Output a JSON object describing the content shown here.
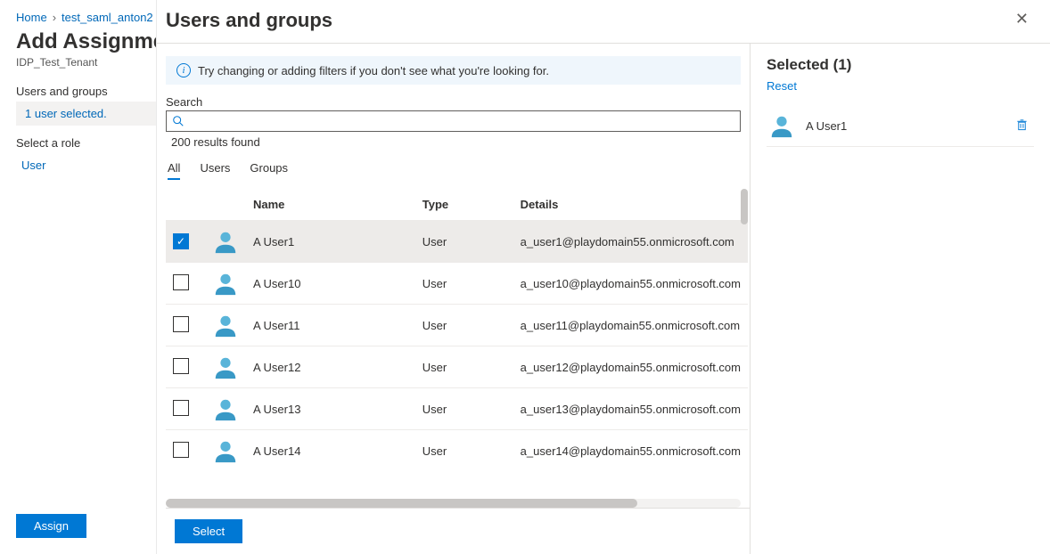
{
  "breadcrumb": {
    "home": "Home",
    "app": "test_saml_anton2"
  },
  "page": {
    "title": "Add Assignment",
    "tenant": "IDP_Test_Tenant"
  },
  "left": {
    "users_groups_label": "Users and groups",
    "selection_text": "1 user selected.",
    "select_role_label": "Select a role",
    "role_value": "User"
  },
  "buttons": {
    "assign": "Assign",
    "select": "Select"
  },
  "panel": {
    "title": "Users and groups",
    "info_text": "Try changing or adding filters if you don't see what you're looking for.",
    "search_label": "Search",
    "search_placeholder": "",
    "results_count": "200 results found",
    "tabs": {
      "all": "All",
      "users": "Users",
      "groups": "Groups",
      "active": "all"
    },
    "columns": {
      "name": "Name",
      "type": "Type",
      "details": "Details"
    }
  },
  "rows": [
    {
      "checked": true,
      "name": "A User1",
      "type": "User",
      "details": "a_user1@playdomain55.onmicrosoft.com"
    },
    {
      "checked": false,
      "name": "A User10",
      "type": "User",
      "details": "a_user10@playdomain55.onmicrosoft.com"
    },
    {
      "checked": false,
      "name": "A User11",
      "type": "User",
      "details": "a_user11@playdomain55.onmicrosoft.com"
    },
    {
      "checked": false,
      "name": "A User12",
      "type": "User",
      "details": "a_user12@playdomain55.onmicrosoft.com"
    },
    {
      "checked": false,
      "name": "A User13",
      "type": "User",
      "details": "a_user13@playdomain55.onmicrosoft.com"
    },
    {
      "checked": false,
      "name": "A User14",
      "type": "User",
      "details": "a_user14@playdomain55.onmicrosoft.com"
    }
  ],
  "selected": {
    "title_prefix": "Selected",
    "count": 1,
    "reset": "Reset",
    "items": [
      {
        "name": "A User1"
      }
    ]
  }
}
